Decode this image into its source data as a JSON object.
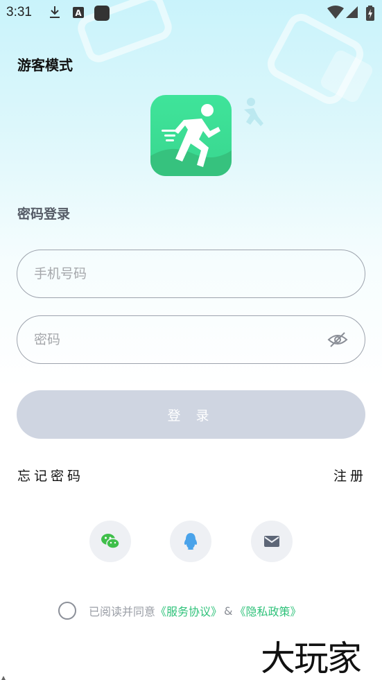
{
  "status_bar": {
    "time": "3:31",
    "icons": [
      "download-icon",
      "font-a-icon",
      "app-square-icon",
      "wifi-icon",
      "signal-icon",
      "battery-charging-icon"
    ]
  },
  "guest_mode": "游客模式",
  "logo": {
    "icon": "running-person-icon",
    "colors": {
      "top": "#3fe49a",
      "bottom": "#39d68f"
    }
  },
  "login": {
    "section_title": "密码登录",
    "phone_placeholder": "手机号码",
    "password_placeholder": "密码",
    "submit_label": "登 录"
  },
  "links": {
    "forgot": "忘记密码",
    "register": "注册"
  },
  "social_login": [
    "wechat-icon",
    "qq-icon",
    "email-icon"
  ],
  "agreement": {
    "prefix": "已阅读并同意",
    "service": "《服务协议》",
    "amp": "&",
    "privacy": "《隐私政策》"
  },
  "watermark": "大玩家",
  "colors": {
    "accent": "#2fc27a",
    "button_disabled": "#cfd5e1",
    "border": "#9da3ad"
  }
}
